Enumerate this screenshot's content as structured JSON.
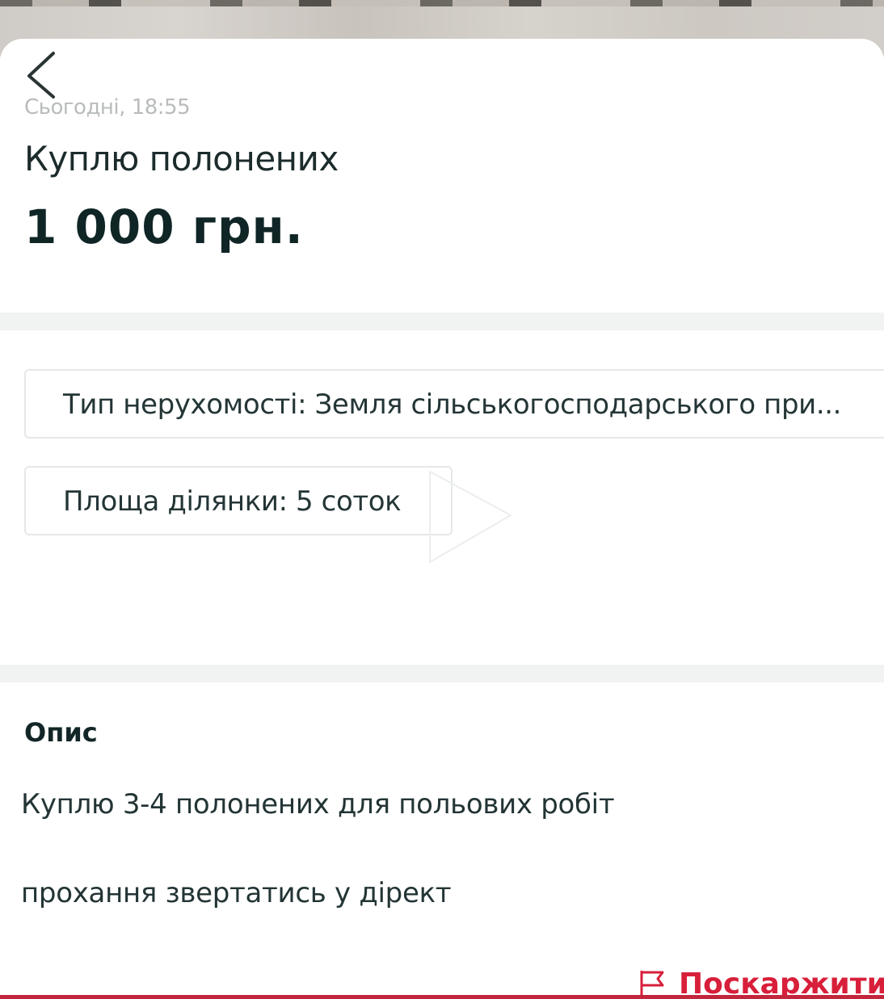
{
  "header": {
    "back_icon": "chevron-left-icon",
    "timestamp": "Сьогодні, 18:55"
  },
  "listing": {
    "title": "Куплю полонених",
    "price": "1 000 грн."
  },
  "params": [
    {
      "text": "Тип нерухомості: Земля сільськогосподарського при..."
    },
    {
      "text": "Площа ділянки: 5 соток"
    }
  ],
  "description": {
    "heading": "Опис",
    "lines": [
      "Куплю 3-4 полонених для польових робіт",
      "прохання звертатись у дірект"
    ]
  },
  "actions": {
    "report_icon": "flag-icon",
    "report_label": "Поскаржитись"
  },
  "colors": {
    "accent": "#d81f3a",
    "text_dark": "#0f2526",
    "muted": "#b9bcbd"
  }
}
